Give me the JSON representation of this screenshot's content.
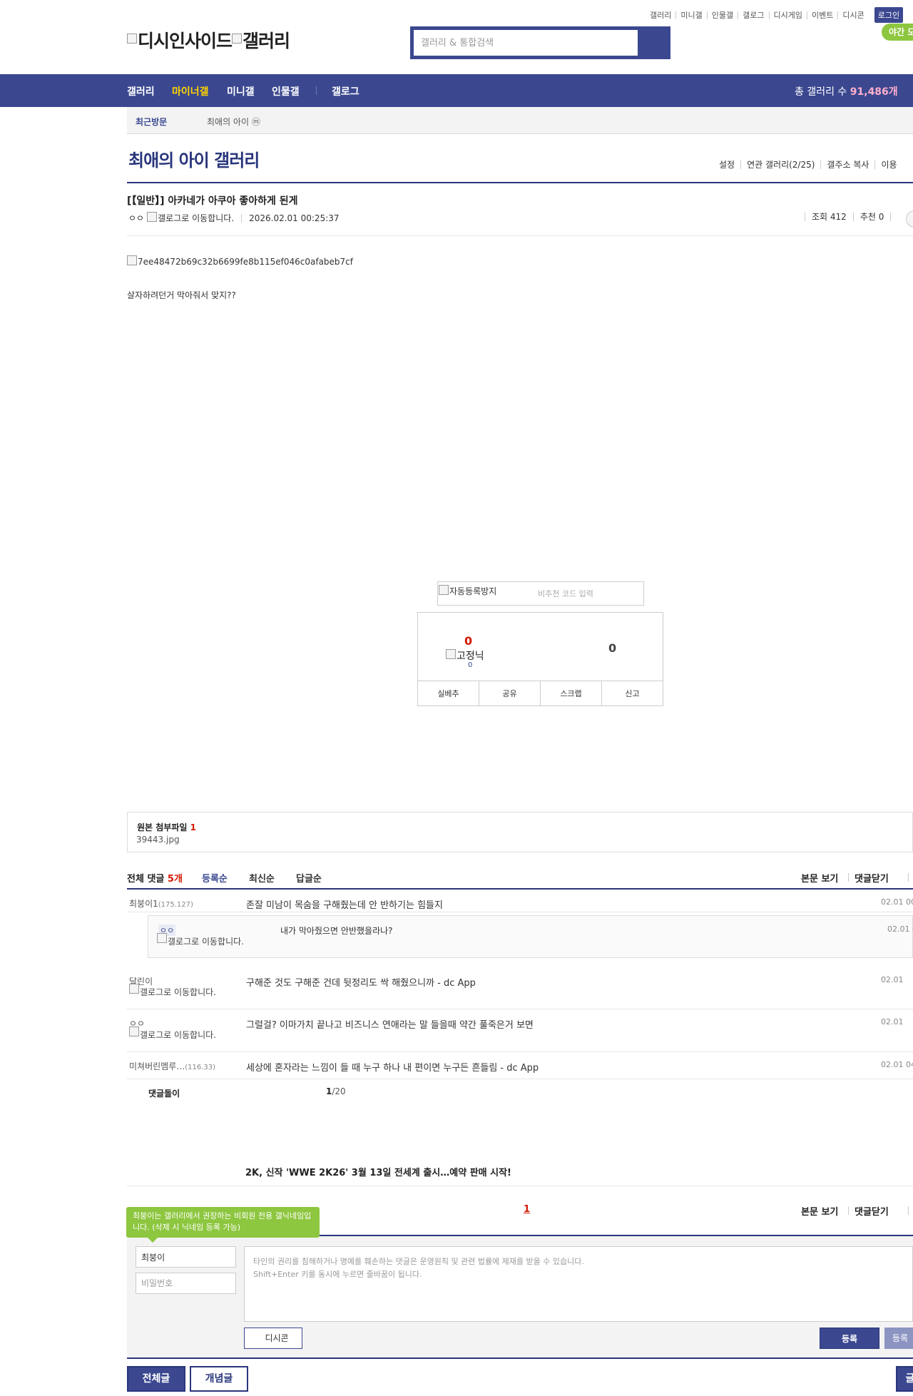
{
  "util_links": [
    "갤러리",
    "미니갤",
    "인물갤",
    "갤로그",
    "디시게임",
    "이벤트",
    "디시콘"
  ],
  "login_label": "로그인",
  "night_label": "야간 모",
  "logo": {
    "part1": "디시인사이드",
    "part2": "갤러리"
  },
  "search": {
    "placeholder": "갤러리 & 통합검색",
    "icon": "search-icon"
  },
  "nav": {
    "items": [
      "갤러리",
      "마이너갤",
      "미니갤",
      "인물갤",
      "갤로그"
    ],
    "active": "마이너갤",
    "total_label": "총 갤러리 수",
    "total_value": "91,486개"
  },
  "recent": {
    "label": "최근방문",
    "item": "최애의 아이 ⓜ"
  },
  "gallery": {
    "title": "최애의 아이 갤러리",
    "menu": [
      "설정",
      "연관 갤러리(2/25)",
      "갤주소 복사",
      "이용"
    ]
  },
  "post": {
    "title": "[【일반】] 아카네가 아쿠아 좋아하게 된게",
    "author": "ㅇㅇ",
    "author_icon_alt": "갤로그로 이동합니다.",
    "date": "2026.02.01 00:25:37",
    "views": "조회 412",
    "recommends": "추천 0",
    "image_alt": "7ee48472b69c32b6699fe8b115ef046c0afabeb7cf",
    "body": "살자하려던거 막아줘서 맞지??"
  },
  "captcha": {
    "image_alt": "자동등록방지",
    "placeholder": "비추천 코드 입력"
  },
  "recommend": {
    "up_count": "0",
    "fixed_alt": "고정닉",
    "fixed_count": "0",
    "down_count": "0",
    "buttons": [
      "실베추",
      "공유",
      "스크랩",
      "신고"
    ]
  },
  "attach": {
    "label": "원본 첨부파일",
    "count": "1",
    "file": "39443.jpg"
  },
  "comments": {
    "all_label": "전체 댓글",
    "all_count": "5개",
    "sort": [
      "등록순",
      "최신순",
      "답글순"
    ],
    "sort_active": "등록순",
    "view_body": "본문 보기",
    "close_comments": "댓글닫기",
    "items": [
      {
        "nick": "최붕이1",
        "ip": "(175.127)",
        "text": "존잘 미남이 목숨을 구해줬는데 안 반하기는 힘들지",
        "date": "02.01 00"
      },
      {
        "nick": "달린이",
        "ip": "",
        "gallog": "갤로그로 이동합니다.",
        "text": "구해준 것도 구해준 건데 뒷정리도 싹 해줬으니까 - dc App",
        "date": "02.01"
      },
      {
        "nick": "ㅇㅇ",
        "ip": "",
        "gallog": "갤로그로 이동합니다.",
        "text": "그럴걸? 이마가치 끝나고 비즈니스 연애라는 말 들을때 약간 풀죽은거 보면",
        "date": "02.01"
      },
      {
        "nick": "미쳐버린멤루…",
        "ip": "(116.33)",
        "text": "세상에 혼자라는 느낌이 들 때 누구 하나 내 편이면 누구든 흔들림 - dc App",
        "date": "02.01 04"
      }
    ],
    "reply": {
      "nick": "ㅇㅇ",
      "gallog": "갤로그로 이동합니다.",
      "text": "내가 막아줬으면 안반했을라나?",
      "date": "02.01 0"
    },
    "dolgi": "댓글돌이",
    "page_current": "1",
    "page_total": "/20"
  },
  "ad_text": "2K, 신작 'WWE 2K26' 3월 13일 전세계 출시…예약 판매 시작!",
  "pagination_current": "1",
  "write": {
    "tip": "최붕이는 갤러리에서 권장하는 비회원 전용 갤닉네임입니다. (삭제 시 닉네임 등록 가능)",
    "nick_value": "최붕이",
    "password_placeholder": "비밀번호",
    "textarea_placeholder": "타인의 권리를 침해하거나 명예를 훼손하는 댓글은 운영원칙 및 관련 법률에 제재를 받을 수 있습니다.\nShift+Enter 키를 동시에 누르면 줄바꿈이 됩니다.",
    "dccon_label": "디시콘",
    "submit_label": "등록",
    "submit2_label": "등록"
  },
  "bottom": {
    "all_posts": "전체글",
    "concept_posts": "개념글",
    "right_btn": "글"
  }
}
